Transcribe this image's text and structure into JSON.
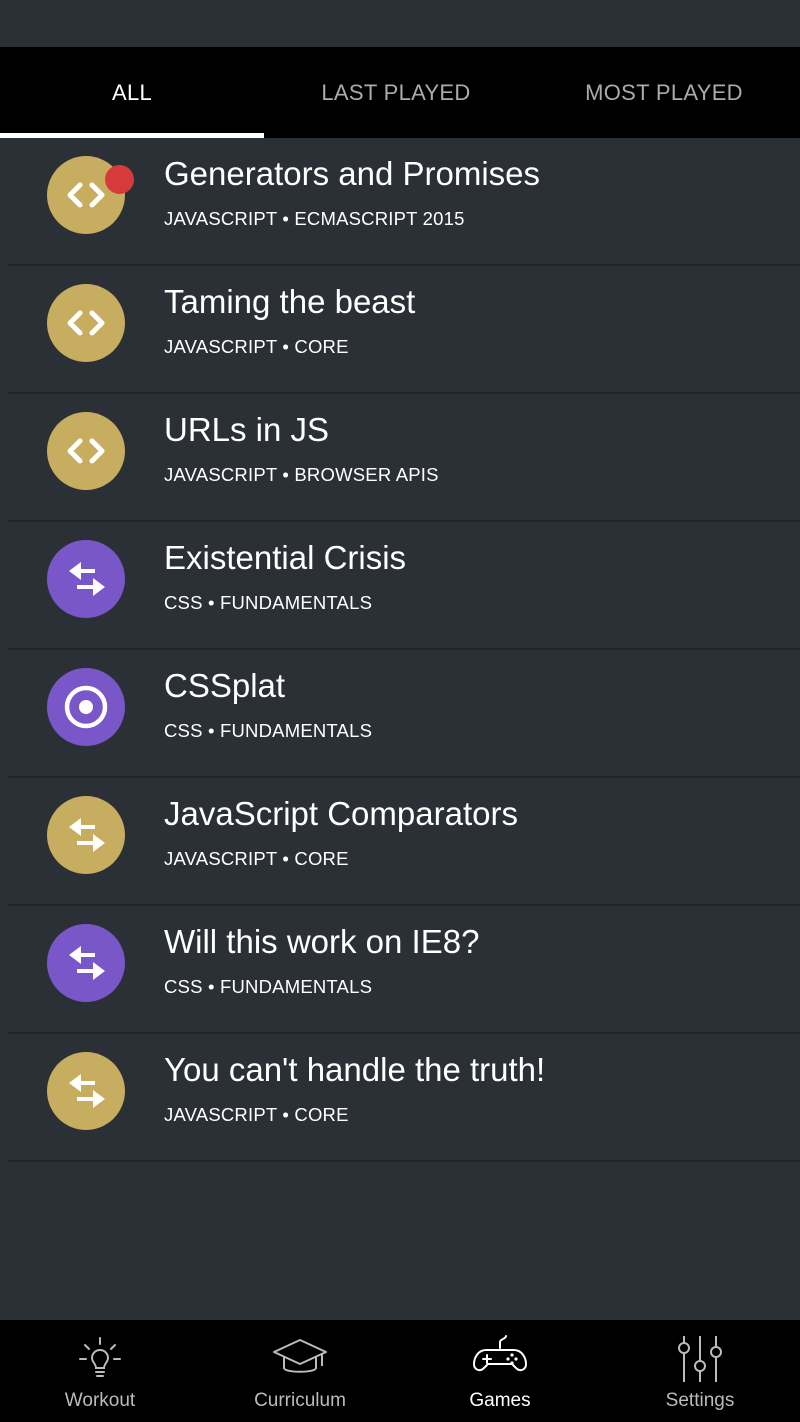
{
  "tabs": [
    {
      "label": "ALL",
      "active": true
    },
    {
      "label": "LAST PLAYED",
      "active": false
    },
    {
      "label": "MOST PLAYED",
      "active": false
    }
  ],
  "games": [
    {
      "title": "Generators and Promises",
      "subtitle": "JAVASCRIPT • ECMASCRIPT 2015",
      "icon": "code-icon",
      "color": "#c7ad5f",
      "has_notification": true
    },
    {
      "title": "Taming the beast",
      "subtitle": "JAVASCRIPT • CORE",
      "icon": "code-icon",
      "color": "#c7ad5f"
    },
    {
      "title": "URLs in JS",
      "subtitle": "JAVASCRIPT • BROWSER APIS",
      "icon": "code-icon",
      "color": "#c7ad5f"
    },
    {
      "title": "Existential Crisis",
      "subtitle": "CSS • FUNDAMENTALS",
      "icon": "swap-arrows-icon",
      "color": "#7a57c9"
    },
    {
      "title": "CSSplat",
      "subtitle": "CSS • FUNDAMENTALS",
      "icon": "target-icon",
      "color": "#7a57c9"
    },
    {
      "title": "JavaScript Comparators",
      "subtitle": "JAVASCRIPT • CORE",
      "icon": "swap-arrows-icon",
      "color": "#c7ad5f"
    },
    {
      "title": "Will this work on IE8?",
      "subtitle": "CSS • FUNDAMENTALS",
      "icon": "swap-arrows-icon",
      "color": "#7a57c9"
    },
    {
      "title": "You can't handle the truth!",
      "subtitle": "JAVASCRIPT • CORE",
      "icon": "swap-arrows-icon",
      "color": "#c7ad5f"
    }
  ],
  "nav": [
    {
      "label": "Workout",
      "icon": "lightbulb-icon",
      "active": false
    },
    {
      "label": "Curriculum",
      "icon": "graduation-cap-icon",
      "active": false
    },
    {
      "label": "Games",
      "icon": "gamepad-icon",
      "active": true
    },
    {
      "label": "Settings",
      "icon": "sliders-icon",
      "active": false
    }
  ],
  "colors": {
    "background": "#2b2f36",
    "gold": "#c7ad5f",
    "purple": "#7a57c9",
    "notification": "#d63a3a"
  }
}
